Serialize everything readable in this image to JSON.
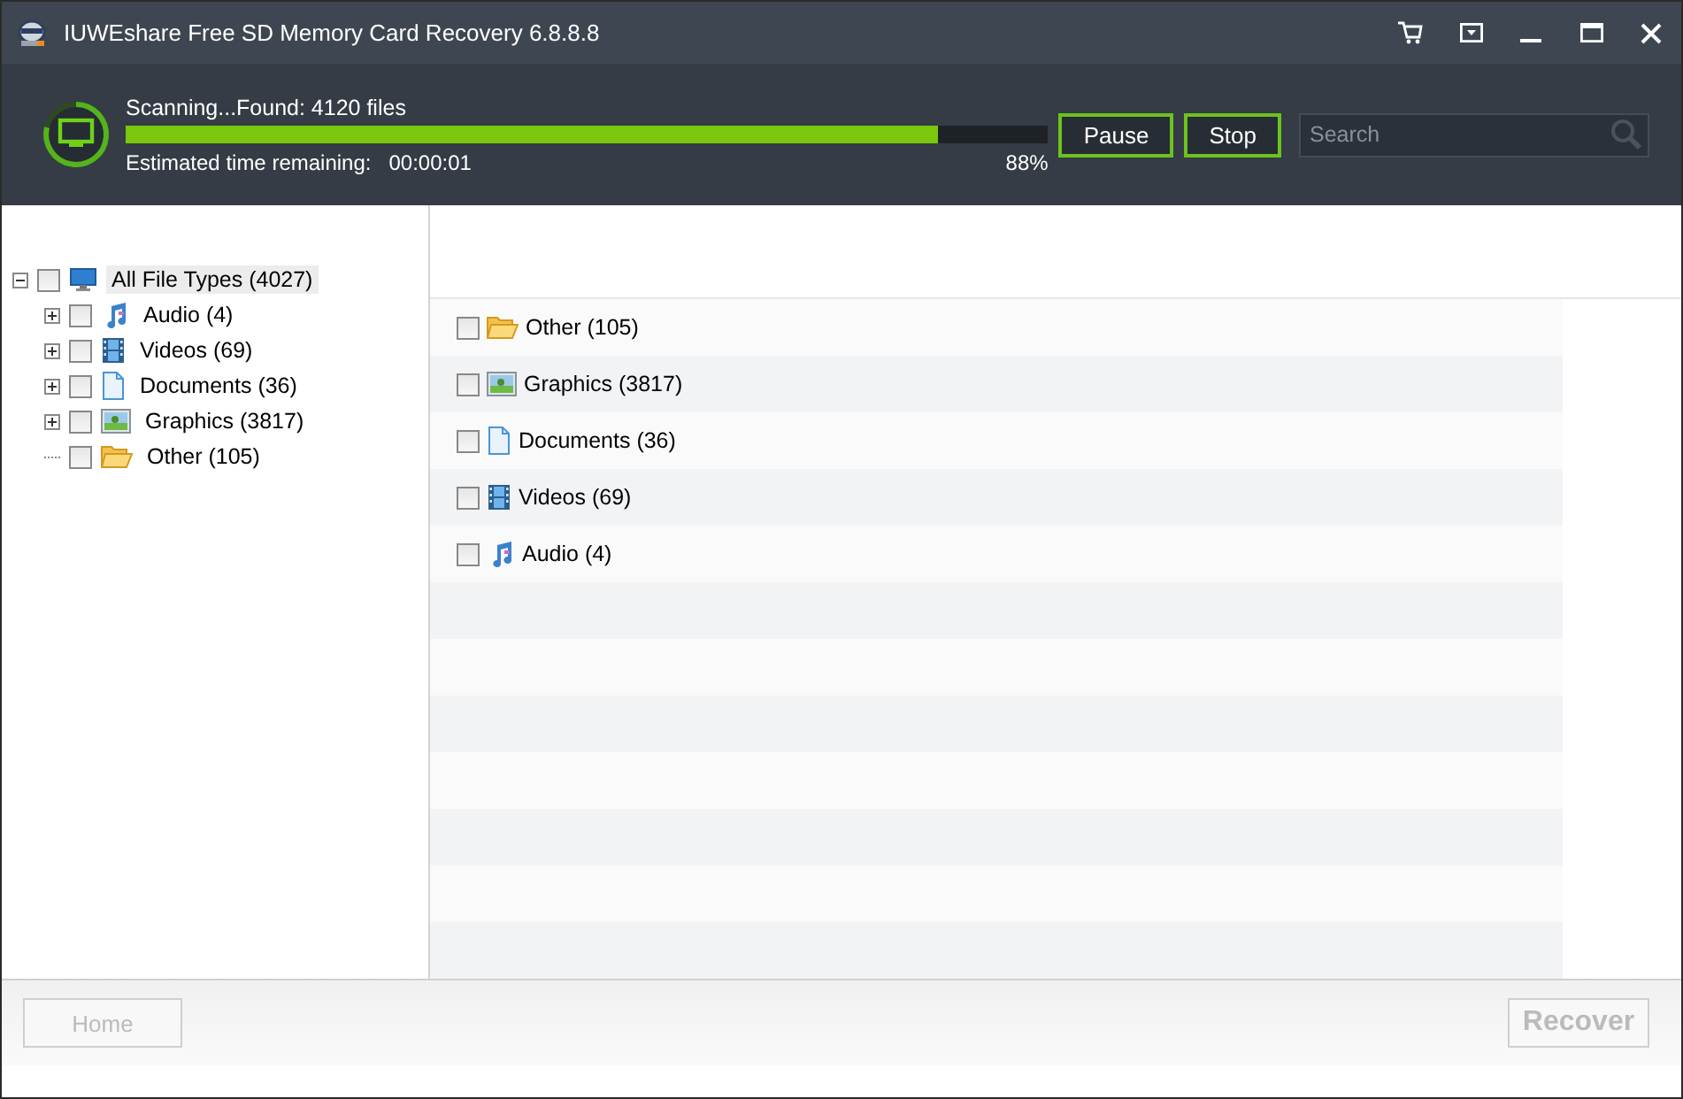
{
  "window": {
    "title": "IUWEshare Free SD Memory Card Recovery 6.8.8.8"
  },
  "scan": {
    "status": "Scanning...Found: 4120 files",
    "level": 0.88,
    "percent": "88%",
    "time_label": "Estimated time remaining:",
    "time_value": "00:00:01"
  },
  "controls": {
    "buttons": [
      "Pause",
      "Stop"
    ],
    "search": {
      "placeholder": "Search"
    }
  },
  "tree": {
    "label": "All File Types (4027)",
    "kind": "computer",
    "checked": false,
    "expanded": true,
    "selected": true,
    "children": [
      {
        "label": "Audio (4)",
        "kind": "audio",
        "checked": false,
        "expanded": false,
        "selected": false
      },
      {
        "label": "Videos (69)",
        "kind": "video",
        "checked": false,
        "expanded": false,
        "selected": false
      },
      {
        "label": "Documents (36)",
        "kind": "document",
        "checked": false,
        "expanded": false,
        "selected": false
      },
      {
        "label": "Graphics (3817)",
        "kind": "graphics",
        "checked": false,
        "expanded": false,
        "selected": false
      },
      {
        "label": "Other (105)",
        "kind": "other",
        "checked": false,
        "selected": false
      }
    ]
  },
  "list": [
    {
      "label": "Other (105)",
      "kind": "other",
      "checked": false
    },
    {
      "label": "Graphics (3817)",
      "kind": "graphics",
      "checked": false
    },
    {
      "label": "Documents (36)",
      "kind": "document",
      "checked": false
    },
    {
      "label": "Videos (69)",
      "kind": "video",
      "checked": false
    },
    {
      "label": "Audio (4)",
      "kind": "audio",
      "checked": false
    }
  ],
  "footer": {
    "home": {
      "label": "Home",
      "disabled": true
    },
    "recover": {
      "label": "Recover",
      "disabled": true
    }
  }
}
